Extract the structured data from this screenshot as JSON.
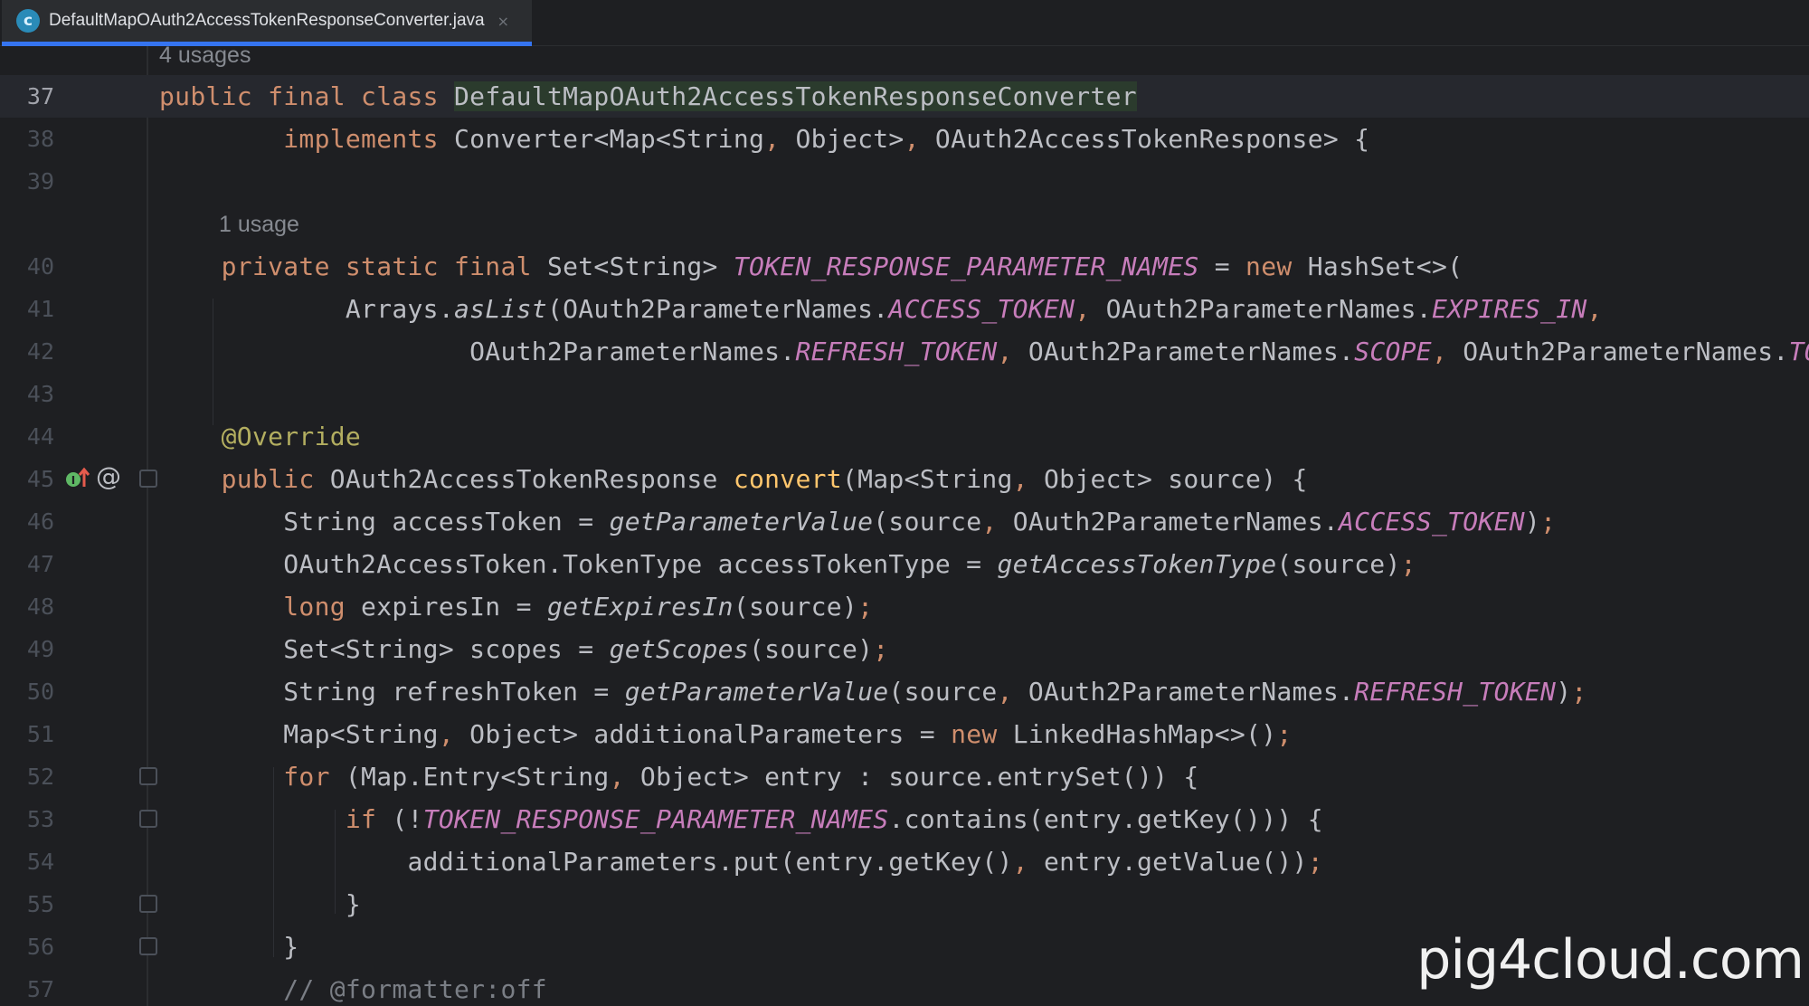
{
  "tab": {
    "title": "DefaultMapOAuth2AccessTokenResponseConverter.java",
    "icon": "java-class-icon",
    "close": "×"
  },
  "usages": {
    "class": "4 usages",
    "field": "1 usage"
  },
  "line_numbers": [
    "37",
    "38",
    "39",
    "40",
    "41",
    "42",
    "43",
    "44",
    "45",
    "46",
    "47",
    "48",
    "49",
    "50",
    "51",
    "52",
    "53",
    "54",
    "55",
    "56",
    "57"
  ],
  "code": {
    "l37": {
      "a": "public final class ",
      "b": "DefaultMapOAuth2AccessTokenResponseConverter"
    },
    "l38": {
      "a": "        implements ",
      "b": "Converter<Map<String",
      "c": ", ",
      "d": "Object>",
      "e": ", ",
      "f": "OAuth2AccessTokenResponse> {"
    },
    "l40": {
      "a": "    private static final ",
      "b": "Set<String> ",
      "c": "TOKEN_RESPONSE_PARAMETER_NAMES",
      "d": " = ",
      "e": "new ",
      "f": "HashSet<>("
    },
    "l41": {
      "a": "            Arrays.",
      "b": "asList",
      "c": "(OAuth2ParameterNames.",
      "d": "ACCESS_TOKEN",
      "e": ", ",
      "f": "OAuth2ParameterNames.",
      "g": "EXPIRES_IN",
      "h": ","
    },
    "l42": {
      "a": "                    OAuth2ParameterNames.",
      "b": "REFRESH_TOKEN",
      "c": ", ",
      "d": "OAuth2ParameterNames.",
      "e": "SCOPE",
      "f": ", ",
      "g": "OAuth2ParameterNames.",
      "h": "TOKE"
    },
    "l44": {
      "a": "    @Override"
    },
    "l45": {
      "a": "    public ",
      "b": "OAuth2AccessTokenResponse ",
      "c": "convert",
      "d": "(Map<String",
      "e": ", ",
      "f": "Object> source) {"
    },
    "l46": {
      "a": "        String accessToken = ",
      "b": "getParameterValue",
      "c": "(source",
      "d": ", ",
      "e": "OAuth2ParameterNames.",
      "f": "ACCESS_TOKEN",
      "g": ")",
      "h": ";"
    },
    "l47": {
      "a": "        OAuth2AccessToken.TokenType accessTokenType = ",
      "b": "getAccessTokenType",
      "c": "(source)",
      "d": ";"
    },
    "l48": {
      "a": "        long ",
      "b": "expiresIn = ",
      "c": "getExpiresIn",
      "d": "(source)",
      "e": ";"
    },
    "l49": {
      "a": "        Set<String> scopes = ",
      "b": "getScopes",
      "c": "(source)",
      "d": ";"
    },
    "l50": {
      "a": "        String refreshToken = ",
      "b": "getParameterValue",
      "c": "(source",
      "d": ", ",
      "e": "OAuth2ParameterNames.",
      "f": "REFRESH_TOKEN",
      "g": ")",
      "h": ";"
    },
    "l51": {
      "a": "        Map<String",
      "b": ", ",
      "c": "Object> additionalParameters = ",
      "d": "new ",
      "e": "LinkedHashMap<>()",
      "f": ";"
    },
    "l52": {
      "a": "        for ",
      "b": "(Map.Entry<String",
      "c": ", ",
      "d": "Object> entry : source.entrySet()) {"
    },
    "l53": {
      "a": "            if ",
      "b": "(!",
      "c": "TOKEN_RESPONSE_PARAMETER_NAMES",
      "d": ".contains(entry.getKey())) {"
    },
    "l54": {
      "a": "                additionalParameters.put(entry.getKey()",
      "b": ", ",
      "c": "entry.getValue())",
      "d": ";"
    },
    "l55": {
      "a": "            }"
    },
    "l56": {
      "a": "        }"
    },
    "l57": {
      "a": "        // @formatter:off"
    }
  },
  "gutter_icons": {
    "override": "overrides-method-icon",
    "annotation": "@"
  },
  "watermark": "pig4cloud.com",
  "colors": {
    "background": "#1e1f22",
    "keyword": "#cf8e6d",
    "field": "#c77dbb",
    "method": "#56a8f5",
    "annotation": "#b3ae60",
    "comment": "#7a7e85",
    "tab_accent": "#3574f0"
  }
}
